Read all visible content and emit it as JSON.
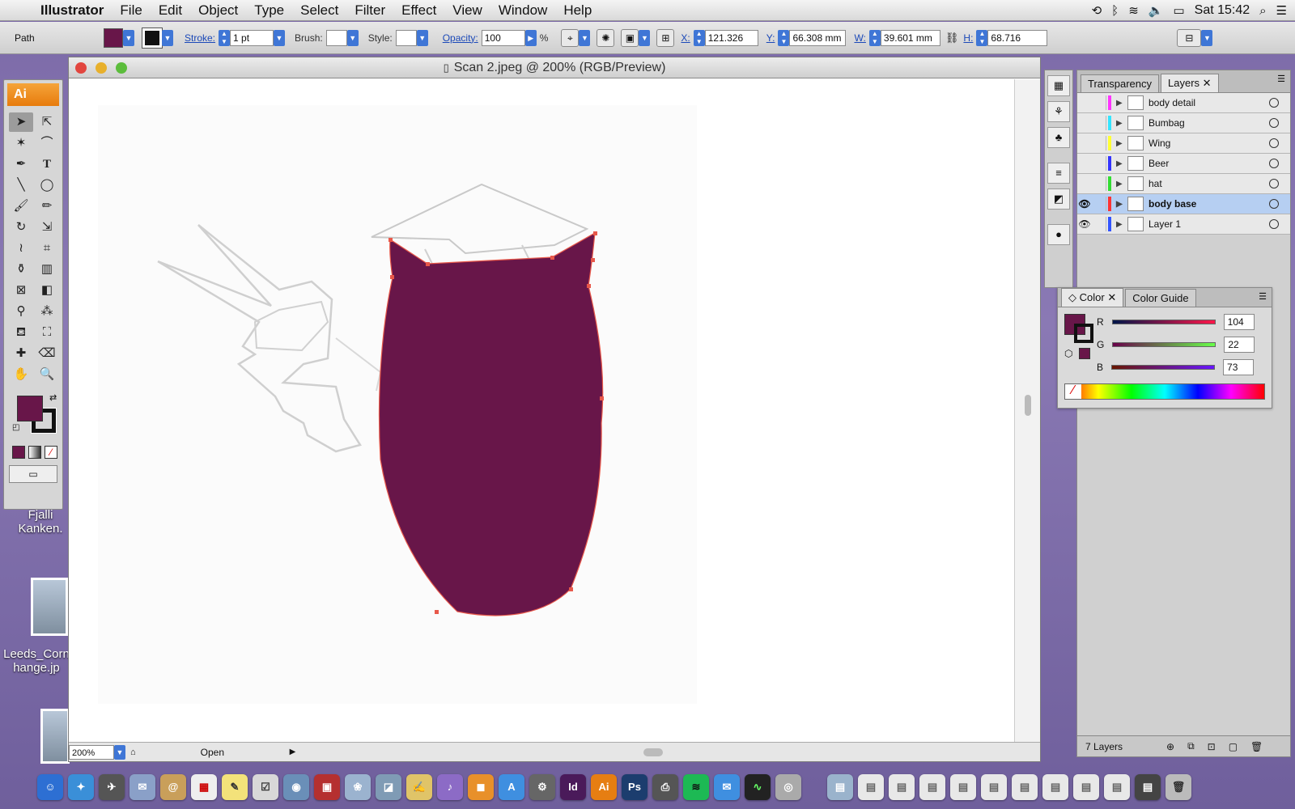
{
  "menubar": {
    "app": "Illustrator",
    "items": [
      "File",
      "Edit",
      "Object",
      "Type",
      "Select",
      "Filter",
      "Effect",
      "View",
      "Window",
      "Help"
    ],
    "clock": "Sat 15:42"
  },
  "control": {
    "selection": "Path",
    "stroke_label": "Stroke:",
    "stroke_value": "1 pt",
    "brush_label": "Brush:",
    "style_label": "Style:",
    "opacity_label": "Opacity:",
    "opacity_value": "100",
    "opacity_unit": "%",
    "x_label": "X:",
    "x_value": "121.326",
    "y_label": "Y:",
    "y_value": "66.308 mm",
    "w_label": "W:",
    "w_value": "39.601 mm",
    "h_label": "H:",
    "h_value": "68.716"
  },
  "tools": {
    "badge": "Ai"
  },
  "document": {
    "title": "Scan 2.jpeg @ 200% (RGB/Preview)",
    "zoom": "200%",
    "status": "Open",
    "fill_color": "#681649"
  },
  "layers": {
    "tabs": [
      "Transparency",
      "Layers"
    ],
    "rows": [
      {
        "name": "body detail",
        "visible": false,
        "color": "#ff33ff"
      },
      {
        "name": "Bumbag",
        "visible": false,
        "color": "#33e5ff"
      },
      {
        "name": "Wing",
        "visible": false,
        "color": "#ffff33"
      },
      {
        "name": "Beer",
        "visible": false,
        "color": "#3333ff"
      },
      {
        "name": "hat",
        "visible": false,
        "color": "#33dd33"
      },
      {
        "name": "body base",
        "visible": true,
        "color": "#ff3333",
        "selected": true
      },
      {
        "name": "Layer 1",
        "visible": true,
        "color": "#3355ff"
      }
    ],
    "count": "7 Layers"
  },
  "color": {
    "tabs": [
      "Color",
      "Color Guide"
    ],
    "r_label": "R",
    "r_value": "104",
    "g_label": "G",
    "g_value": "22",
    "b_label": "B",
    "b_value": "73"
  },
  "desktop": {
    "icons": [
      "Fjalli Kanken.",
      "Leeds_Corn hange.jp"
    ]
  },
  "dock_apps": [
    {
      "label": "Id",
      "color": "#4a1a5a"
    },
    {
      "label": "Ai",
      "color": "#e67e12"
    },
    {
      "label": "Ps",
      "color": "#1c3d6e"
    }
  ]
}
